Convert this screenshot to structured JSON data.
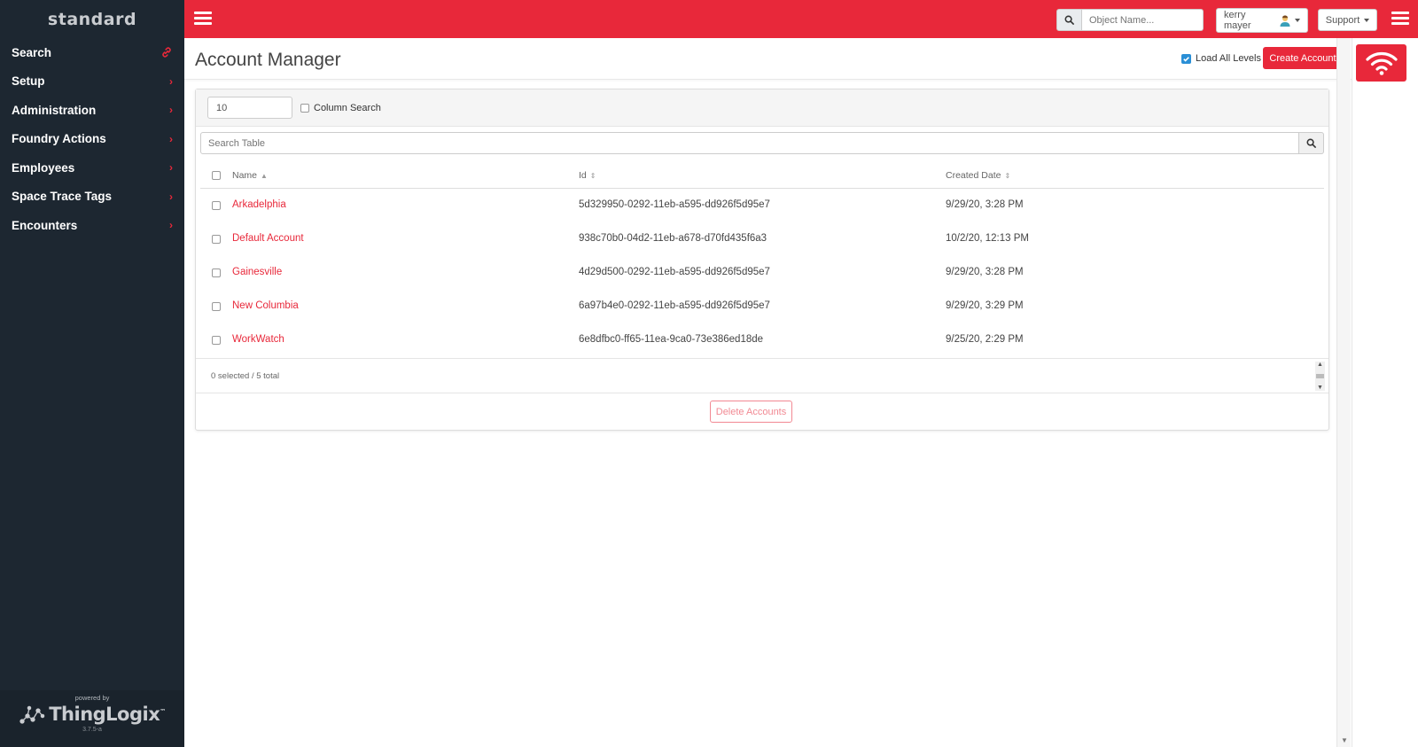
{
  "brand": {
    "name": "standard"
  },
  "sidebar": {
    "items": [
      {
        "label": "Search",
        "icon": "link-icon"
      },
      {
        "label": "Setup",
        "icon": "chevron-right-icon"
      },
      {
        "label": "Administration",
        "icon": "chevron-right-icon"
      },
      {
        "label": "Foundry Actions",
        "icon": "chevron-right-icon"
      },
      {
        "label": "Employees",
        "icon": "chevron-right-icon"
      },
      {
        "label": "Space Trace Tags",
        "icon": "chevron-right-icon"
      },
      {
        "label": "Encounters",
        "icon": "chevron-right-icon"
      }
    ],
    "footer": {
      "powered_by": "powered by",
      "vendor": "ThingLogix",
      "trademark": "™",
      "version": "3.7.5-a"
    }
  },
  "topbar": {
    "search_placeholder": "Object Name...",
    "user_name": "kerry mayer",
    "support_label": "Support"
  },
  "main": {
    "title": "Account Manager",
    "load_all_levels_label": "Load All Levels",
    "load_all_levels_checked": true,
    "create_button": "Create Account",
    "page_size_value": "10",
    "column_search_label": "Column Search",
    "search_table_placeholder": "Search Table",
    "columns": [
      {
        "label": "Name",
        "sort": "▲"
      },
      {
        "label": "Id",
        "sort": "⇕"
      },
      {
        "label": "Created Date",
        "sort": "⇕"
      }
    ],
    "rows": [
      {
        "name": "Arkadelphia",
        "id": "5d329950-0292-11eb-a595-dd926f5d95e7",
        "created": "9/29/20, 3:28 PM"
      },
      {
        "name": "Default Account",
        "id": "938c70b0-04d2-11eb-a678-d70fd435f6a3",
        "created": "10/2/20, 12:13 PM"
      },
      {
        "name": "Gainesville",
        "id": "4d29d500-0292-11eb-a595-dd926f5d95e7",
        "created": "9/29/20, 3:28 PM"
      },
      {
        "name": "New Columbia",
        "id": "6a97b4e0-0292-11eb-a595-dd926f5d95e7",
        "created": "9/29/20, 3:29 PM"
      },
      {
        "name": "WorkWatch",
        "id": "6e8dfbc0-ff65-11ea-9ca0-73e386ed18de",
        "created": "9/25/20, 2:29 PM"
      }
    ],
    "selection_summary": "0 selected / 5 total",
    "delete_button": "Delete Accounts"
  },
  "colors": {
    "accent": "#e8283a",
    "sidebar_bg": "#1d2731",
    "checkbox_blue": "#2a8fd6"
  }
}
